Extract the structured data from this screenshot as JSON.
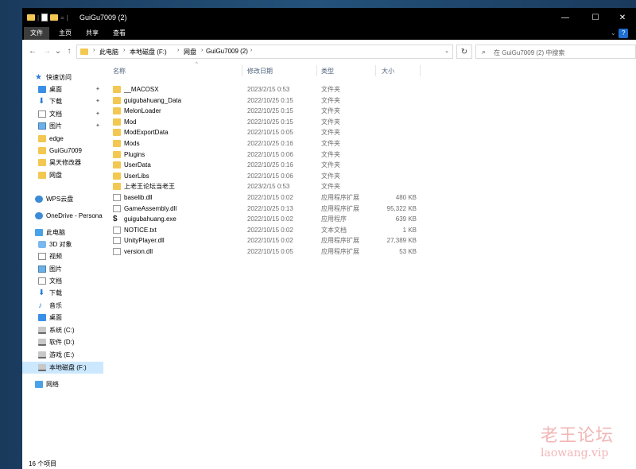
{
  "window": {
    "title": "GuiGu7009 (2)",
    "minimize_glyph": "—",
    "maximize_glyph": "☐",
    "close_glyph": "✕"
  },
  "ribbon": {
    "tabs": [
      "文件",
      "主页",
      "共享",
      "查看"
    ],
    "active_tab": "文件"
  },
  "nav": {
    "back_glyph": "←",
    "forward_glyph": "→",
    "recent_glyph": "⌄",
    "up_glyph": "↑",
    "refresh_glyph": "↻",
    "breadcrumb": [
      "此电脑",
      "本地磁盘 (F:)",
      "网盘",
      "GuiGu7009 (2)"
    ],
    "separator": "›",
    "search_placeholder": "在 GuiGu7009 (2) 中搜索"
  },
  "sidebar": {
    "items": [
      {
        "label": "快速访问",
        "icon": "star-icon",
        "pinned": false
      },
      {
        "label": "桌面",
        "icon": "desktop-icon",
        "pinned": true
      },
      {
        "label": "下载",
        "icon": "download-icon",
        "pinned": true
      },
      {
        "label": "文档",
        "icon": "document-icon",
        "pinned": true
      },
      {
        "label": "图片",
        "icon": "pictures-icon",
        "pinned": true
      },
      {
        "label": "edge",
        "icon": "folder-icon",
        "pinned": false
      },
      {
        "label": "GuiGu7009",
        "icon": "folder-icon",
        "pinned": false
      },
      {
        "label": "昊天修改器",
        "icon": "folder-icon",
        "pinned": false
      },
      {
        "label": "网盘",
        "icon": "folder-icon",
        "pinned": false
      },
      {
        "label": "WPS云盘",
        "icon": "cloud-icon",
        "pinned": false
      },
      {
        "label": "OneDrive - Persona",
        "icon": "onedrive-icon",
        "pinned": false
      },
      {
        "label": "此电脑",
        "icon": "pc-icon",
        "pinned": false
      },
      {
        "label": "3D 对象",
        "icon": "3d-objects-icon",
        "pinned": false
      },
      {
        "label": "视频",
        "icon": "video-icon",
        "pinned": false
      },
      {
        "label": "图片",
        "icon": "pictures-icon",
        "pinned": false
      },
      {
        "label": "文档",
        "icon": "document-icon",
        "pinned": false
      },
      {
        "label": "下载",
        "icon": "download-icon",
        "pinned": false
      },
      {
        "label": "音乐",
        "icon": "music-icon",
        "pinned": false
      },
      {
        "label": "桌面",
        "icon": "desktop-icon",
        "pinned": false
      },
      {
        "label": "系统 (C:)",
        "icon": "drive-icon",
        "pinned": false
      },
      {
        "label": "软件 (D:)",
        "icon": "drive-icon",
        "pinned": false
      },
      {
        "label": "游戏 (E:)",
        "icon": "drive-icon",
        "pinned": false
      },
      {
        "label": "本地磁盘 (F:)",
        "icon": "drive-icon",
        "pinned": false,
        "selected": true
      },
      {
        "label": "网络",
        "icon": "network-icon",
        "pinned": false
      }
    ],
    "pin_glyph": "📌"
  },
  "columns": {
    "name": "名称",
    "date": "修改日期",
    "type": "类型",
    "size": "大小",
    "sort_glyph": "^"
  },
  "files": [
    {
      "name": "__MACOSX",
      "date": "2023/2/15 0:53",
      "type": "文件夹",
      "size": "",
      "kind": "folder"
    },
    {
      "name": "guigubahuang_Data",
      "date": "2022/10/25 0:15",
      "type": "文件夹",
      "size": "",
      "kind": "folder"
    },
    {
      "name": "MelonLoader",
      "date": "2022/10/25 0:15",
      "type": "文件夹",
      "size": "",
      "kind": "folder"
    },
    {
      "name": "Mod",
      "date": "2022/10/25 0:15",
      "type": "文件夹",
      "size": "",
      "kind": "folder"
    },
    {
      "name": "ModExportData",
      "date": "2022/10/15 0:05",
      "type": "文件夹",
      "size": "",
      "kind": "folder"
    },
    {
      "name": "Mods",
      "date": "2022/10/25 0:16",
      "type": "文件夹",
      "size": "",
      "kind": "folder"
    },
    {
      "name": "Plugins",
      "date": "2022/10/15 0:06",
      "type": "文件夹",
      "size": "",
      "kind": "folder"
    },
    {
      "name": "UserData",
      "date": "2022/10/25 0:16",
      "type": "文件夹",
      "size": "",
      "kind": "folder"
    },
    {
      "name": "UserLibs",
      "date": "2022/10/15 0:06",
      "type": "文件夹",
      "size": "",
      "kind": "folder"
    },
    {
      "name": "上老王论坛当老王",
      "date": "2023/2/15 0:53",
      "type": "文件夹",
      "size": "",
      "kind": "folder"
    },
    {
      "name": "baselib.dll",
      "date": "2022/10/15 0:02",
      "type": "应用程序扩展",
      "size": "480 KB",
      "kind": "dll"
    },
    {
      "name": "GameAssembly.dll",
      "date": "2022/10/25 0:13",
      "type": "应用程序扩展",
      "size": "95,322 KB",
      "kind": "dll"
    },
    {
      "name": "guigubahuang.exe",
      "date": "2022/10/15 0:02",
      "type": "应用程序",
      "size": "639 KB",
      "kind": "exe"
    },
    {
      "name": "NOTICE.txt",
      "date": "2022/10/15 0:02",
      "type": "文本文档",
      "size": "1 KB",
      "kind": "txt"
    },
    {
      "name": "UnityPlayer.dll",
      "date": "2022/10/15 0:02",
      "type": "应用程序扩展",
      "size": "27,389 KB",
      "kind": "dll"
    },
    {
      "name": "version.dll",
      "date": "2022/10/15 0:05",
      "type": "应用程序扩展",
      "size": "53 KB",
      "kind": "dll"
    }
  ],
  "status": {
    "item_count": "16 个项目"
  },
  "watermark": {
    "cn": "老王论坛",
    "en": "laowang.vip"
  },
  "colors": {
    "folder": "#f3c852",
    "selected": "#cce8ff",
    "accent": "#2b7bd6"
  }
}
